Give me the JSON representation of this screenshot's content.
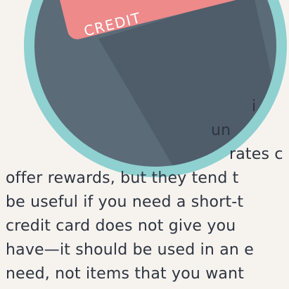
{
  "card": {
    "label": "CREDIT",
    "colors": {
      "ring": "#8fd0d0",
      "disc": "#5b6b78",
      "shadow": "#4c5a66",
      "card_face": "#ee8a8a",
      "card_tab": "#d9e6ee",
      "chip": "#8ec8de"
    }
  },
  "article": {
    "text_color": "#2e3440",
    "wrapped_lines": [
      "i",
      "un",
      "rates c"
    ],
    "lines": [
      "offer rewards, but they tend t",
      "be useful if you need a short-t",
      "credit card does not give you",
      "have—it should be used in an e",
      "need, not items that you want"
    ]
  }
}
